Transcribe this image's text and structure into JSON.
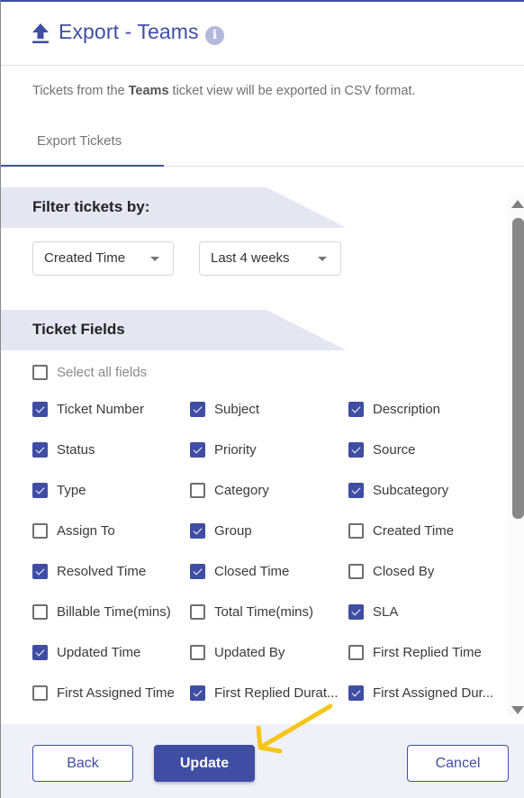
{
  "header": {
    "title": "Export - Teams",
    "icon": "upload-icon",
    "info_icon": "info-icon",
    "info_glyph": "i"
  },
  "description": {
    "prefix": "Tickets from the ",
    "view_name": "Teams",
    "suffix": " ticket view will be exported in CSV format."
  },
  "tabs": [
    {
      "label": "Export Tickets",
      "active": true
    }
  ],
  "filter": {
    "heading": "Filter tickets by:",
    "field_select": {
      "value": "Created Time"
    },
    "range_select": {
      "value": "Last 4 weeks"
    }
  },
  "ticket_fields": {
    "heading": "Ticket Fields",
    "select_all": {
      "label": "Select all fields",
      "checked": false
    },
    "fields": [
      {
        "label": "Ticket Number",
        "checked": true
      },
      {
        "label": "Subject",
        "checked": true
      },
      {
        "label": "Description",
        "checked": true
      },
      {
        "label": "Status",
        "checked": true
      },
      {
        "label": "Priority",
        "checked": true
      },
      {
        "label": "Source",
        "checked": true
      },
      {
        "label": "Type",
        "checked": true
      },
      {
        "label": "Category",
        "checked": false
      },
      {
        "label": "Subcategory",
        "checked": true
      },
      {
        "label": "Assign To",
        "checked": false
      },
      {
        "label": "Group",
        "checked": true
      },
      {
        "label": "Created Time",
        "checked": false
      },
      {
        "label": "Resolved Time",
        "checked": true
      },
      {
        "label": "Closed Time",
        "checked": true
      },
      {
        "label": "Closed By",
        "checked": false
      },
      {
        "label": "Billable Time(mins)",
        "checked": false
      },
      {
        "label": "Total Time(mins)",
        "checked": false
      },
      {
        "label": "SLA",
        "checked": true
      },
      {
        "label": "Updated Time",
        "checked": true
      },
      {
        "label": "Updated By",
        "checked": false
      },
      {
        "label": "First Replied Time",
        "checked": false
      },
      {
        "label": "First Assigned Time",
        "checked": false
      },
      {
        "label": "First Replied Durat...",
        "checked": true
      },
      {
        "label": "First Assigned Dur...",
        "checked": true
      }
    ]
  },
  "footer": {
    "back_label": "Back",
    "update_label": "Update",
    "cancel_label": "Cancel"
  },
  "colors": {
    "accent": "#3f4ea3",
    "section_band": "#e6e6f3",
    "footer_bg": "#f0f1f8",
    "annotation_arrow": "#f5c518"
  }
}
